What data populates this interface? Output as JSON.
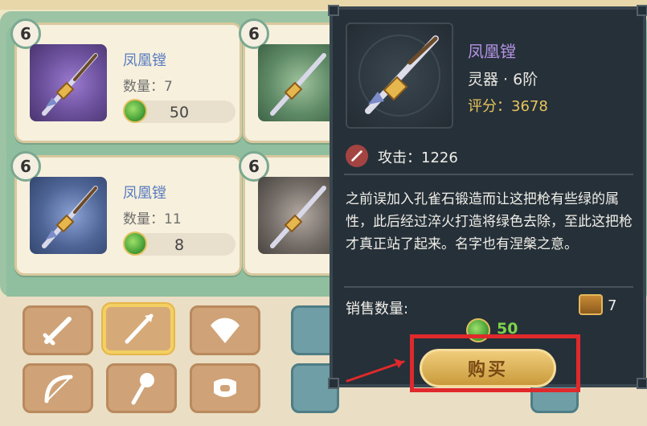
{
  "items": [
    {
      "level": "6",
      "name": "凤凰镗",
      "quantity": "数量：7",
      "price": "50"
    },
    {
      "level": "6",
      "name": "凤凰镗",
      "quantity": "数量：11",
      "price": "8"
    },
    {
      "level": "6"
    },
    {
      "level": "6"
    }
  ],
  "detail": {
    "name": "凤凰镗",
    "type": "灵器 · 6阶",
    "score": "评分：3678",
    "attack": "攻击：1226",
    "description": "之前误加入孔雀石锻造而让这把枪有些绿的属性，此后经过淬火打造将绿色去除，至此这把枪才真正站了起来。名字也有涅槃之意。",
    "sell_label": "销售数量:",
    "stock": "7",
    "price": "50",
    "buy_label": "购买"
  },
  "categories": [
    "sword-icon",
    "spear-icon",
    "fan-icon",
    "bow-icon",
    "axe-icon",
    "ring-icon"
  ],
  "colors": {
    "accent_highlight": "#e0292a",
    "coin": "#4aa33a",
    "name_purple": "#b493e5",
    "score_gold": "#e7c45c"
  }
}
